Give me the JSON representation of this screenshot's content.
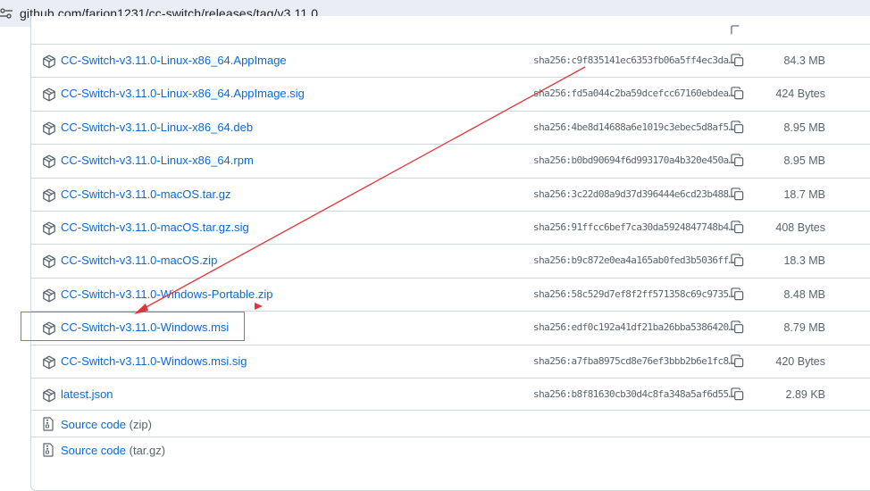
{
  "browser": {
    "url": "github.com/farion1231/cc-switch/releases/tag/v3.11.0"
  },
  "assets": [
    {
      "name": "CC-Switch-v3.11.0-Linux-x86_64.AppImage",
      "sha": "sha256:c9f835141ec6353fb06a5ff4ec3da…",
      "size": "84.3 MB"
    },
    {
      "name": "CC-Switch-v3.11.0-Linux-x86_64.AppImage.sig",
      "sha": "sha256:fd5a044c2ba59dcefcc67160ebdea…",
      "size": "424 Bytes"
    },
    {
      "name": "CC-Switch-v3.11.0-Linux-x86_64.deb",
      "sha": "sha256:4be8d14688a6e1019c3ebec5d8af5…",
      "size": "8.95 MB"
    },
    {
      "name": "CC-Switch-v3.11.0-Linux-x86_64.rpm",
      "sha": "sha256:b0bd90694f6d993170a4b320e450a…",
      "size": "8.95 MB"
    },
    {
      "name": "CC-Switch-v3.11.0-macOS.tar.gz",
      "sha": "sha256:3c22d08a9d37d396444e6cd23b488…",
      "size": "18.7 MB"
    },
    {
      "name": "CC-Switch-v3.11.0-macOS.tar.gz.sig",
      "sha": "sha256:91ffcc6bef7ca30da5924847748b4…",
      "size": "408 Bytes"
    },
    {
      "name": "CC-Switch-v3.11.0-macOS.zip",
      "sha": "sha256:b9c872e0ea4a165ab0fed3b5036ff…",
      "size": "18.3 MB"
    },
    {
      "name": "CC-Switch-v3.11.0-Windows-Portable.zip",
      "sha": "sha256:58c529d7ef8f2ff571358c69c9735…",
      "size": "8.48 MB"
    },
    {
      "name": "CC-Switch-v3.11.0-Windows.msi",
      "sha": "sha256:edf0c192a41df21ba26bba5386420…",
      "size": "8.79 MB"
    },
    {
      "name": "CC-Switch-v3.11.0-Windows.msi.sig",
      "sha": "sha256:a7fba8975cd8e76ef3bbb2b6e1fc8…",
      "size": "420 Bytes"
    },
    {
      "name": "latest.json",
      "sha": "sha256:b8f81630cb30d4c8fa348a5af6d55…",
      "size": "2.89 KB"
    }
  ],
  "source_code": [
    {
      "label": "Source code",
      "ext": "(zip)"
    },
    {
      "label": "Source code",
      "ext": "(tar.gz)"
    }
  ],
  "colors": {
    "link": "#0969da",
    "muted": "#59636e",
    "border": "#d1d9e0",
    "annotation": "#e0343a"
  },
  "icons": {
    "asset": "package-icon",
    "copy": "copy-icon",
    "source": "file-zip-icon",
    "site_info": "tune-icon"
  }
}
